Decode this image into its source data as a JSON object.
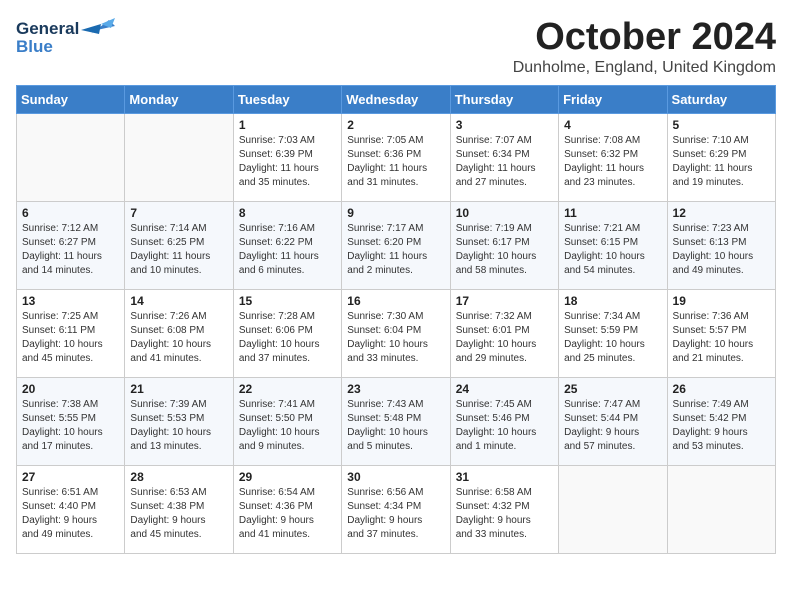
{
  "header": {
    "logo_general": "General",
    "logo_blue": "Blue",
    "month_title": "October 2024",
    "location": "Dunholme, England, United Kingdom"
  },
  "weekdays": [
    "Sunday",
    "Monday",
    "Tuesday",
    "Wednesday",
    "Thursday",
    "Friday",
    "Saturday"
  ],
  "weeks": [
    [
      {
        "day": "",
        "content": ""
      },
      {
        "day": "",
        "content": ""
      },
      {
        "day": "1",
        "content": "Sunrise: 7:03 AM\nSunset: 6:39 PM\nDaylight: 11 hours\nand 35 minutes."
      },
      {
        "day": "2",
        "content": "Sunrise: 7:05 AM\nSunset: 6:36 PM\nDaylight: 11 hours\nand 31 minutes."
      },
      {
        "day": "3",
        "content": "Sunrise: 7:07 AM\nSunset: 6:34 PM\nDaylight: 11 hours\nand 27 minutes."
      },
      {
        "day": "4",
        "content": "Sunrise: 7:08 AM\nSunset: 6:32 PM\nDaylight: 11 hours\nand 23 minutes."
      },
      {
        "day": "5",
        "content": "Sunrise: 7:10 AM\nSunset: 6:29 PM\nDaylight: 11 hours\nand 19 minutes."
      }
    ],
    [
      {
        "day": "6",
        "content": "Sunrise: 7:12 AM\nSunset: 6:27 PM\nDaylight: 11 hours\nand 14 minutes."
      },
      {
        "day": "7",
        "content": "Sunrise: 7:14 AM\nSunset: 6:25 PM\nDaylight: 11 hours\nand 10 minutes."
      },
      {
        "day": "8",
        "content": "Sunrise: 7:16 AM\nSunset: 6:22 PM\nDaylight: 11 hours\nand 6 minutes."
      },
      {
        "day": "9",
        "content": "Sunrise: 7:17 AM\nSunset: 6:20 PM\nDaylight: 11 hours\nand 2 minutes."
      },
      {
        "day": "10",
        "content": "Sunrise: 7:19 AM\nSunset: 6:17 PM\nDaylight: 10 hours\nand 58 minutes."
      },
      {
        "day": "11",
        "content": "Sunrise: 7:21 AM\nSunset: 6:15 PM\nDaylight: 10 hours\nand 54 minutes."
      },
      {
        "day": "12",
        "content": "Sunrise: 7:23 AM\nSunset: 6:13 PM\nDaylight: 10 hours\nand 49 minutes."
      }
    ],
    [
      {
        "day": "13",
        "content": "Sunrise: 7:25 AM\nSunset: 6:11 PM\nDaylight: 10 hours\nand 45 minutes."
      },
      {
        "day": "14",
        "content": "Sunrise: 7:26 AM\nSunset: 6:08 PM\nDaylight: 10 hours\nand 41 minutes."
      },
      {
        "day": "15",
        "content": "Sunrise: 7:28 AM\nSunset: 6:06 PM\nDaylight: 10 hours\nand 37 minutes."
      },
      {
        "day": "16",
        "content": "Sunrise: 7:30 AM\nSunset: 6:04 PM\nDaylight: 10 hours\nand 33 minutes."
      },
      {
        "day": "17",
        "content": "Sunrise: 7:32 AM\nSunset: 6:01 PM\nDaylight: 10 hours\nand 29 minutes."
      },
      {
        "day": "18",
        "content": "Sunrise: 7:34 AM\nSunset: 5:59 PM\nDaylight: 10 hours\nand 25 minutes."
      },
      {
        "day": "19",
        "content": "Sunrise: 7:36 AM\nSunset: 5:57 PM\nDaylight: 10 hours\nand 21 minutes."
      }
    ],
    [
      {
        "day": "20",
        "content": "Sunrise: 7:38 AM\nSunset: 5:55 PM\nDaylight: 10 hours\nand 17 minutes."
      },
      {
        "day": "21",
        "content": "Sunrise: 7:39 AM\nSunset: 5:53 PM\nDaylight: 10 hours\nand 13 minutes."
      },
      {
        "day": "22",
        "content": "Sunrise: 7:41 AM\nSunset: 5:50 PM\nDaylight: 10 hours\nand 9 minutes."
      },
      {
        "day": "23",
        "content": "Sunrise: 7:43 AM\nSunset: 5:48 PM\nDaylight: 10 hours\nand 5 minutes."
      },
      {
        "day": "24",
        "content": "Sunrise: 7:45 AM\nSunset: 5:46 PM\nDaylight: 10 hours\nand 1 minute."
      },
      {
        "day": "25",
        "content": "Sunrise: 7:47 AM\nSunset: 5:44 PM\nDaylight: 9 hours\nand 57 minutes."
      },
      {
        "day": "26",
        "content": "Sunrise: 7:49 AM\nSunset: 5:42 PM\nDaylight: 9 hours\nand 53 minutes."
      }
    ],
    [
      {
        "day": "27",
        "content": "Sunrise: 6:51 AM\nSunset: 4:40 PM\nDaylight: 9 hours\nand 49 minutes."
      },
      {
        "day": "28",
        "content": "Sunrise: 6:53 AM\nSunset: 4:38 PM\nDaylight: 9 hours\nand 45 minutes."
      },
      {
        "day": "29",
        "content": "Sunrise: 6:54 AM\nSunset: 4:36 PM\nDaylight: 9 hours\nand 41 minutes."
      },
      {
        "day": "30",
        "content": "Sunrise: 6:56 AM\nSunset: 4:34 PM\nDaylight: 9 hours\nand 37 minutes."
      },
      {
        "day": "31",
        "content": "Sunrise: 6:58 AM\nSunset: 4:32 PM\nDaylight: 9 hours\nand 33 minutes."
      },
      {
        "day": "",
        "content": ""
      },
      {
        "day": "",
        "content": ""
      }
    ]
  ]
}
